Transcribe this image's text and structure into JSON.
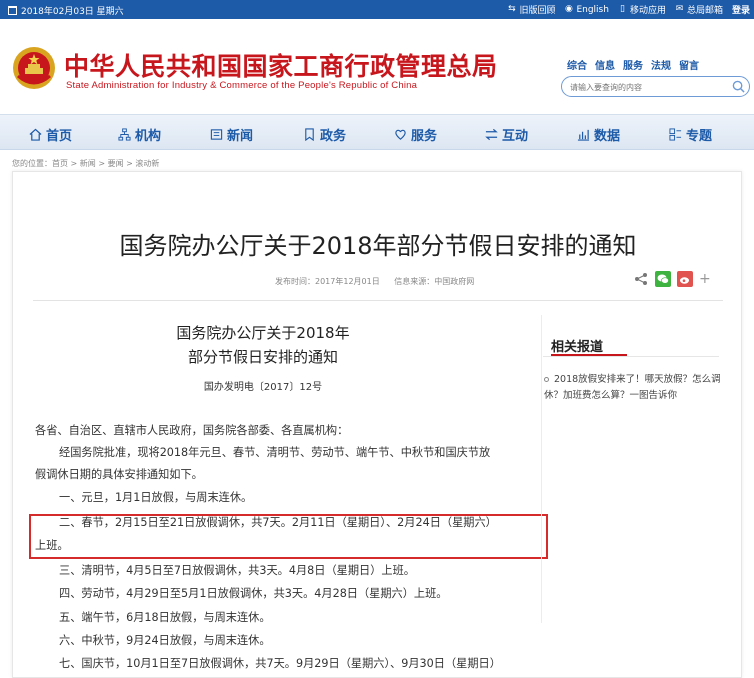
{
  "topbar": {
    "date": "2018年02月03日 星期六",
    "links": [
      "旧版回顾",
      "English",
      "移动应用",
      "总局邮箱"
    ],
    "login": "登录"
  },
  "header": {
    "title_cn": "中华人民共和国国家工商行政管理总局",
    "title_en": "State Administration for Industry & Commerce of the People's Republic of China",
    "quick_links": [
      "综合",
      "信息",
      "服务",
      "法规",
      "留言"
    ],
    "search_placeholder": "请输入要查询的内容"
  },
  "nav": [
    "首页",
    "机构",
    "新闻",
    "政务",
    "服务",
    "互动",
    "数据",
    "专题"
  ],
  "breadcrumb": "您的位置：首页 > 新闻 > 要闻 > 滚动新",
  "article": {
    "title": "国务院办公厅关于2018年部分节假日安排的通知",
    "publish_time": "发布时间：2017年12月01日",
    "source": "信息来源：中国政府网",
    "doc_title_1": "国务院办公厅关于2018年",
    "doc_title_2": "部分节假日安排的通知",
    "doc_no": "国办发明电〔2017〕12号",
    "paragraphs": [
      "各省、自治区、直辖市人民政府，国务院各部委、各直属机构：",
      "经国务院批准，现将2018年元旦、春节、清明节、劳动节、端午节、中秋节和国庆节放",
      "假调休日期的具体安排通知如下。",
      "一、元旦，1月1日放假，与周末连休。",
      "二、春节，2月15日至21日放假调休，共7天。2月11日（星期日）、2月24日（星期六）",
      "上班。",
      "三、清明节，4月5日至7日放假调休，共3天。4月8日（星期日）上班。",
      "四、劳动节，4月29日至5月1日放假调休，共3天。4月28日（星期六）上班。",
      "五、端午节，6月18日放假，与周末连休。",
      "六、中秋节，9月24日放假，与周末连休。",
      "七、国庆节，10月1日至7日放假调休，共7天。9月29日（星期六）、9月30日（星期日）"
    ]
  },
  "related": {
    "title": "相关报道",
    "items": [
      "2018放假安排来了！哪天放假？怎么调休？加班费怎么算？一图告诉你"
    ]
  },
  "share_more": "+",
  "colors": {
    "brand_blue": "#1d5aa8",
    "brand_red": "#c8161d",
    "highlight": "#d62b2b"
  }
}
